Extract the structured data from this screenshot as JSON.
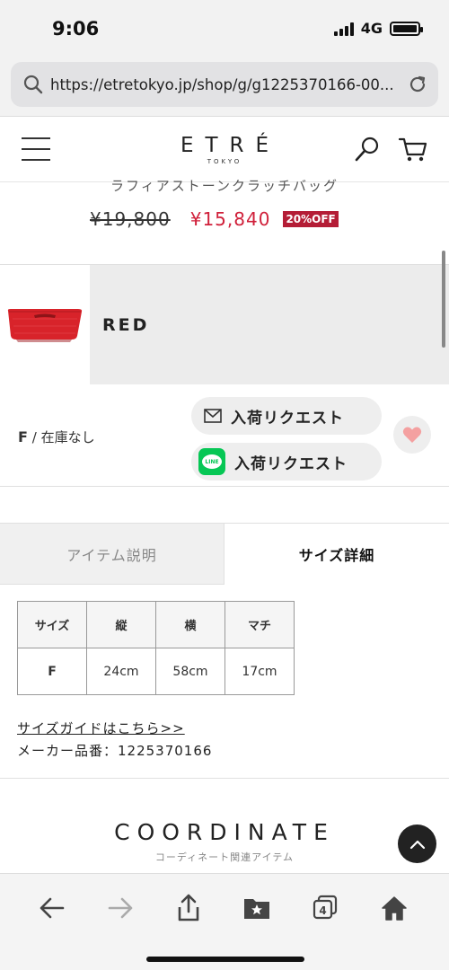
{
  "status_bar": {
    "time": "9:06",
    "network": "4G"
  },
  "browser": {
    "url": "https://etretokyo.jp/shop/g/g1225370166-00..."
  },
  "header": {
    "logo": "ETRÉ",
    "logo_sub": "TOKYO"
  },
  "product": {
    "name_cut": "ラフィアストーンクラッチバッグ",
    "price_old": "¥19,800",
    "price_new": "¥15,840",
    "discount_badge": "20%OFF"
  },
  "color_option": {
    "label": "RED"
  },
  "stock": {
    "size": "F",
    "separator": "/",
    "status": "在庫なし",
    "mail_request_label": "入荷リクエスト",
    "line_request_label": "入荷リクエスト",
    "line_icon_text": "LINE"
  },
  "tabs": {
    "description": "アイテム説明",
    "size_detail": "サイズ詳細"
  },
  "size_table": {
    "headers": [
      "サイズ",
      "縦",
      "横",
      "マチ"
    ],
    "rows": [
      [
        "F",
        "24cm",
        "58cm",
        "17cm"
      ]
    ]
  },
  "size_guide_link": "サイズガイドはこちら>>",
  "maker_number": "メーカー品番：1225370166",
  "coordinate": {
    "title": "COORDINATE",
    "subtitle": "コーディネート関連アイテム"
  },
  "toolbar": {
    "tabs_count": "4"
  },
  "colors": {
    "accent_red": "#d0203a",
    "badge_red": "#b41d36",
    "line_green": "#06c755",
    "heart_pink": "#f4a0a0"
  }
}
